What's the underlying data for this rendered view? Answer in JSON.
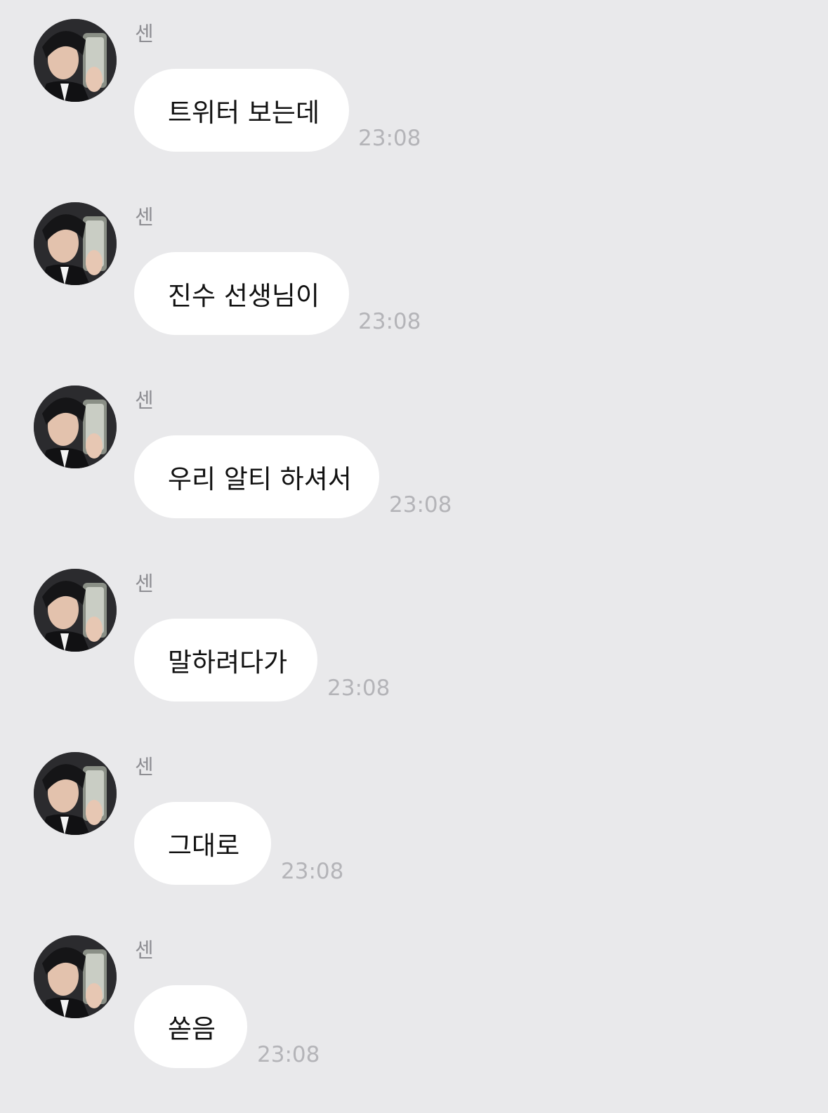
{
  "chat": {
    "messages": [
      {
        "sender": "센",
        "text": "트위터 보는데",
        "time": "23:08"
      },
      {
        "sender": "센",
        "text": "진수 선생님이",
        "time": "23:08"
      },
      {
        "sender": "센",
        "text": "우리 알티 하셔서",
        "time": "23:08"
      },
      {
        "sender": "센",
        "text": "말하려다가",
        "time": "23:08"
      },
      {
        "sender": "센",
        "text": "그대로",
        "time": "23:08"
      },
      {
        "sender": "센",
        "text": "쏟음",
        "time": "23:08"
      }
    ]
  },
  "theme": {
    "background": "#e9e9eb",
    "bubble": "#ffffff",
    "meta_text": "#8e8e93",
    "time_text": "#b4b4b8"
  },
  "icons": {
    "avatar": "profile-photo"
  }
}
